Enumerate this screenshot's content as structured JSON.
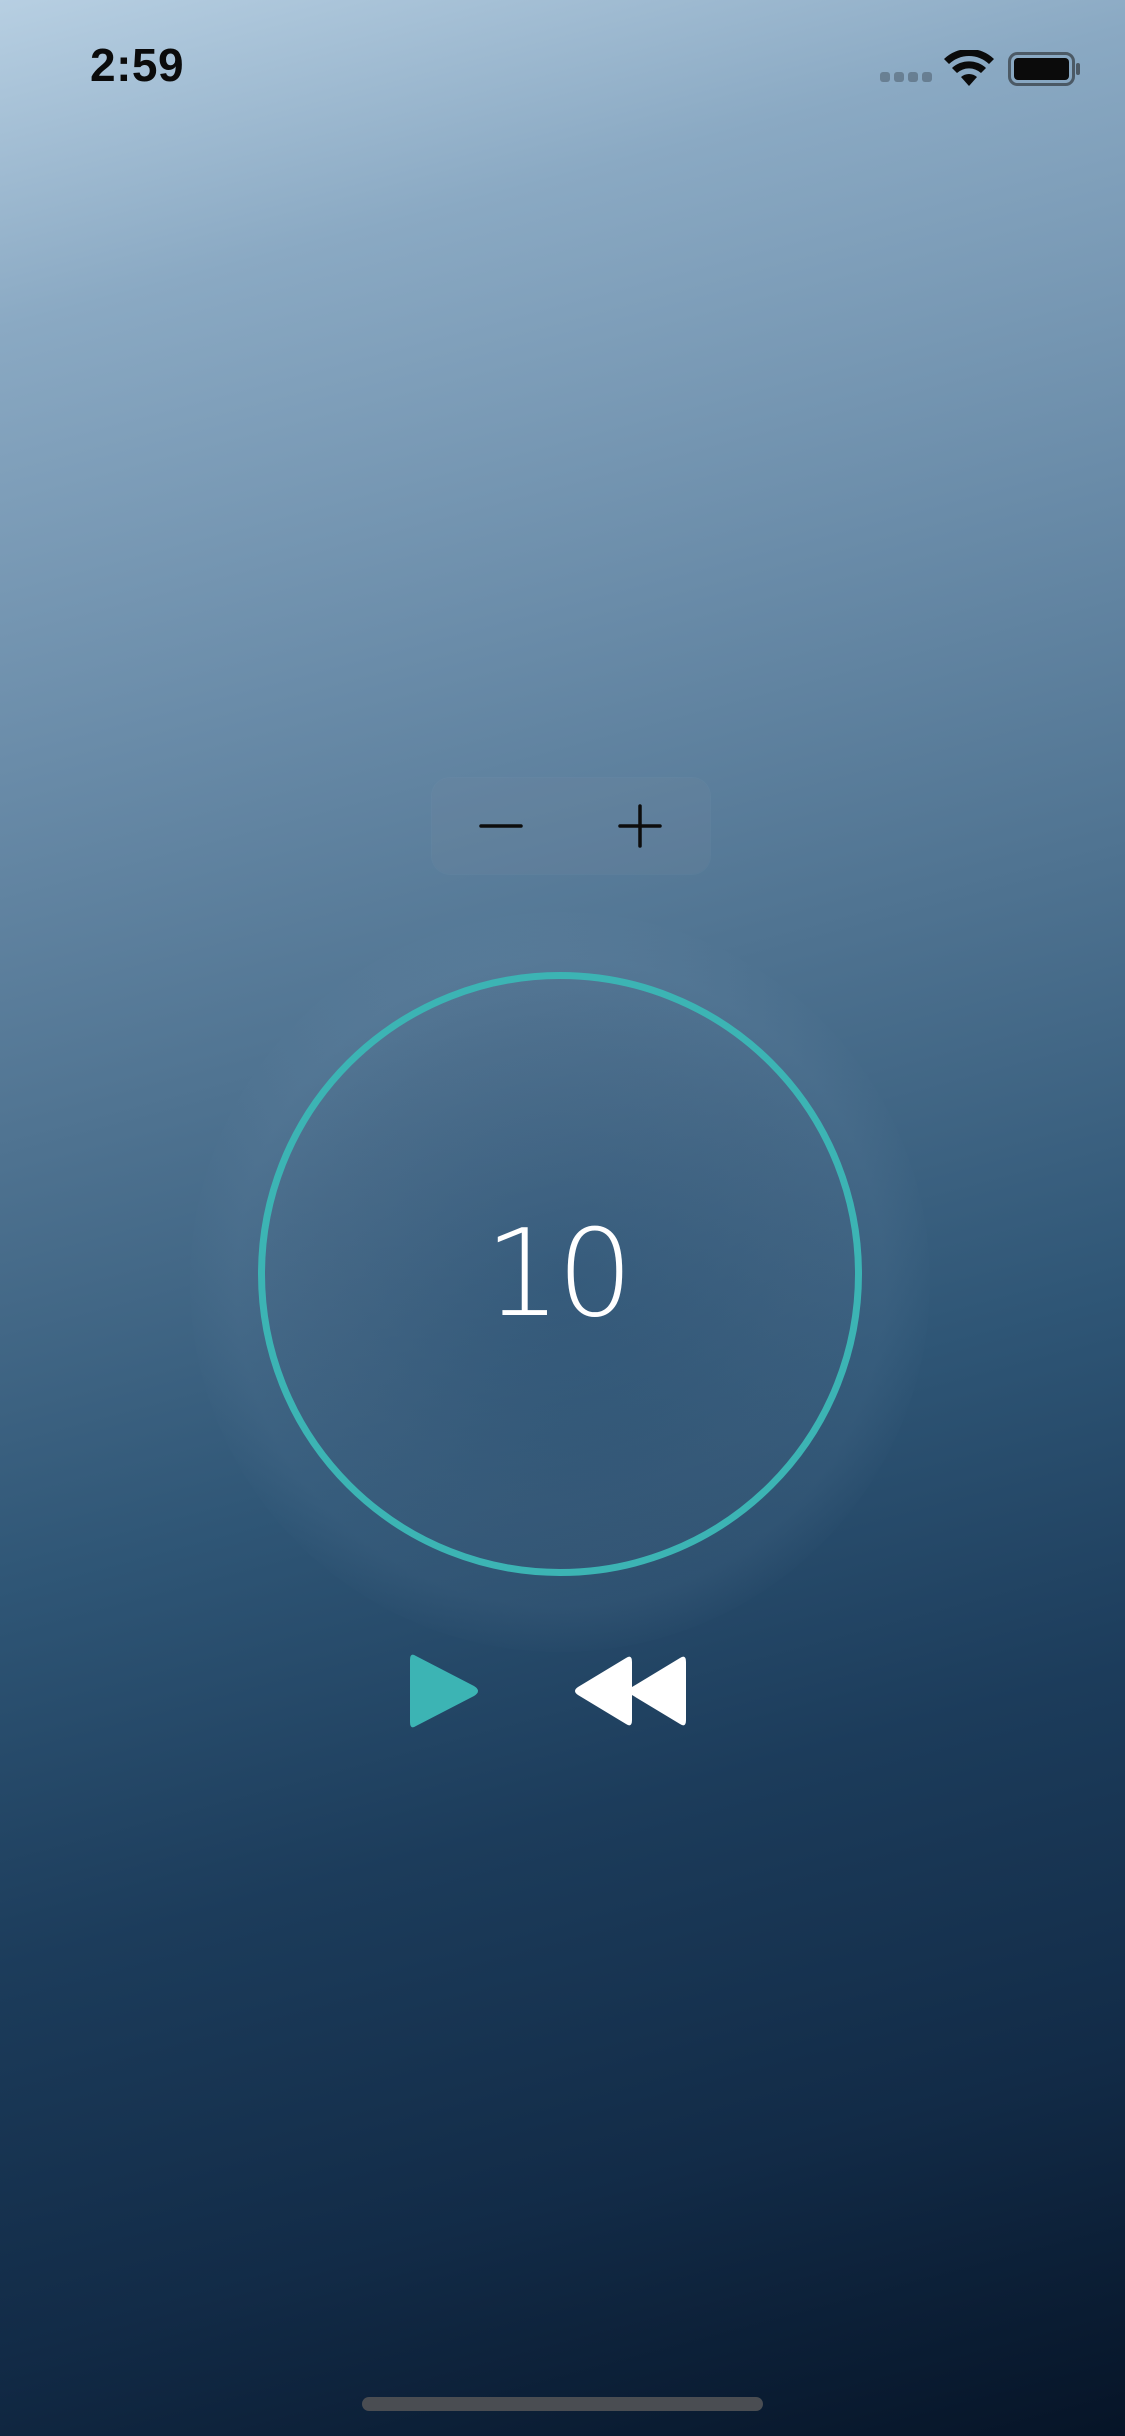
{
  "status_bar": {
    "time": "2:59",
    "signal_icon": "signal-dots-icon",
    "wifi_icon": "wifi-icon",
    "battery_icon": "battery-icon"
  },
  "stepper": {
    "decrement_icon": "minus-icon",
    "increment_icon": "plus-icon"
  },
  "timer": {
    "value": "10",
    "ring_color": "#3cb4b4"
  },
  "controls": {
    "play_icon": "play-icon",
    "play_color": "#3cb4b4",
    "rewind_icon": "rewind-icon",
    "rewind_color": "#ffffff"
  },
  "colors": {
    "background_top": "#b7cfe2",
    "background_bottom": "#061427",
    "accent": "#3cb4b4"
  }
}
